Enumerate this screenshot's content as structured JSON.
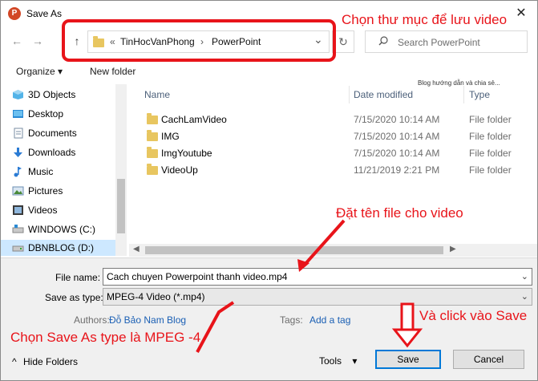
{
  "window": {
    "title": "Save As",
    "app_icon": "powerpoint-icon",
    "close_glyph": "✕"
  },
  "nav": {
    "back": "←",
    "forward": "→",
    "up": "↑"
  },
  "address": {
    "overflow": "«",
    "crumbs": [
      "TinHocVanPhong",
      "PowerPoint"
    ],
    "separator": "›",
    "dropdown": "⌄",
    "refresh": "↻"
  },
  "search": {
    "placeholder": "Search PowerPoint"
  },
  "toolbar": {
    "organize": "Organize",
    "organize_arrow": "▾",
    "new_folder": "New folder",
    "blog_note": "Blog hướng dẫn và chia sẻ..."
  },
  "sidebar": {
    "items": [
      {
        "label": "3D Objects",
        "icon": "3d-objects-icon"
      },
      {
        "label": "Desktop",
        "icon": "desktop-icon"
      },
      {
        "label": "Documents",
        "icon": "documents-icon"
      },
      {
        "label": "Downloads",
        "icon": "downloads-icon"
      },
      {
        "label": "Music",
        "icon": "music-icon"
      },
      {
        "label": "Pictures",
        "icon": "pictures-icon"
      },
      {
        "label": "Videos",
        "icon": "videos-icon"
      },
      {
        "label": "WINDOWS (C:)",
        "icon": "drive-c-icon"
      },
      {
        "label": "DBNBLOG (D:)",
        "icon": "drive-d-icon",
        "selected": true
      }
    ]
  },
  "columns": {
    "name": "Name",
    "date": "Date modified",
    "type": "Type"
  },
  "files": [
    {
      "name": "CachLamVideo",
      "date": "7/15/2020 10:14 AM",
      "type": "File folder"
    },
    {
      "name": "IMG",
      "date": "7/15/2020 10:14 AM",
      "type": "File folder"
    },
    {
      "name": "ImgYoutube",
      "date": "7/15/2020 10:14 AM",
      "type": "File folder"
    },
    {
      "name": "VideoUp",
      "date": "11/21/2019 2:21 PM",
      "type": "File folder"
    }
  ],
  "form": {
    "file_name_label": "File name:",
    "file_name_value": "Cach chuyen Powerpoint thanh video.mp4",
    "save_type_label": "Save as type:",
    "save_type_value": "MPEG-4 Video (*.mp4)",
    "authors_label": "Authors:",
    "authors_value": "Đỗ Bảo Nam Blog",
    "tags_label": "Tags:",
    "tags_value": "Add a tag"
  },
  "footer": {
    "hide_folders": "Hide Folders",
    "hide_arrow": "^",
    "tools": "Tools",
    "tools_arrow": "▾",
    "save": "Save",
    "cancel": "Cancel"
  },
  "annotations": {
    "choose_folder": "Chọn thư mục để lưu video",
    "name_file": "Đặt tên file cho video",
    "choose_type": "Chọn Save As type là MPEG -4",
    "click_save": "Và click vào Save",
    "color": "#e8141a"
  },
  "colors": {
    "accent": "#0078d7",
    "selection": "#cde8ff",
    "folder": "#e8c660"
  }
}
